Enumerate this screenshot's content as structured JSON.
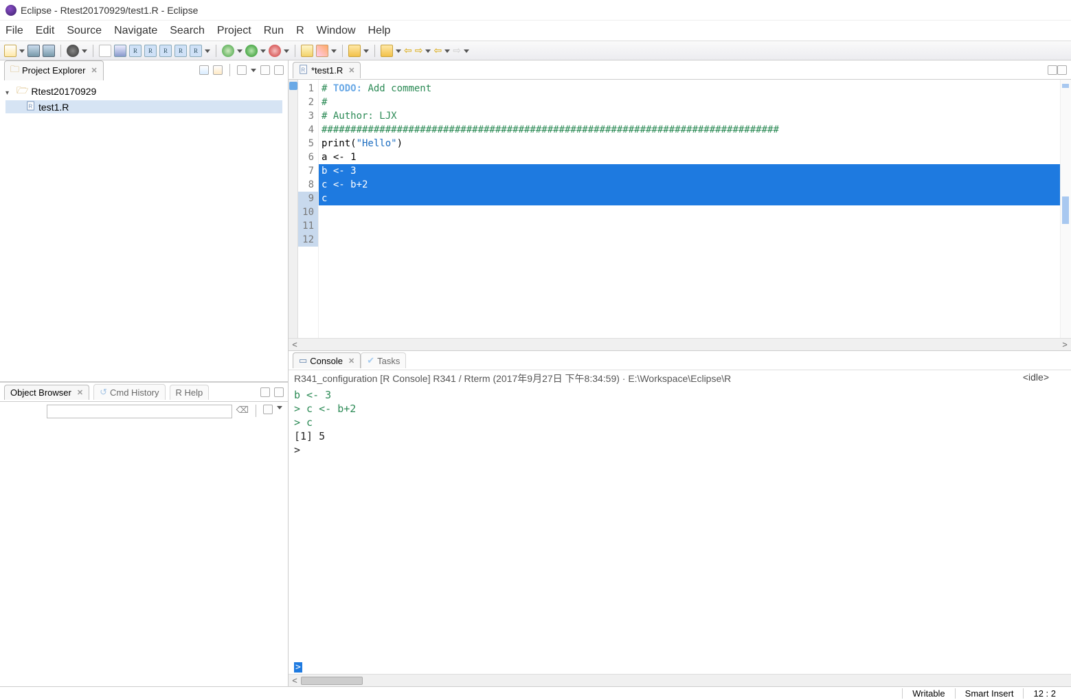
{
  "title": "Eclipse - Rtest20170929/test1.R - Eclipse",
  "menu": [
    "File",
    "Edit",
    "Source",
    "Navigate",
    "Search",
    "Project",
    "Run",
    "R",
    "Window",
    "Help"
  ],
  "projectExplorer": {
    "title": "Project Explorer",
    "projectName": "Rtest20170929",
    "fileName": "test1.R"
  },
  "objectBrowser": {
    "title": "Object Browser",
    "cmdHistory": "Cmd History",
    "rHelp": "R Help"
  },
  "editor": {
    "tabTitle": "*test1.R",
    "lines": [
      {
        "n": 1,
        "content": "# TODO: Add comment",
        "cmt": true,
        "todo": true
      },
      {
        "n": 2,
        "content": "# ",
        "cmt": true
      },
      {
        "n": 3,
        "content": "# Author: LJX",
        "cmt": true
      },
      {
        "n": 4,
        "content": "###############################################################################",
        "cmt": true
      },
      {
        "n": 5,
        "content": ""
      },
      {
        "n": 6,
        "content": ""
      },
      {
        "n": 7,
        "content": "print(\"Hello\")",
        "fn": true
      },
      {
        "n": 8,
        "content": ""
      },
      {
        "n": 9,
        "content": "a <- 1",
        "hl": true
      },
      {
        "n": 10,
        "content": "b <- 3",
        "sel": true
      },
      {
        "n": 11,
        "content": "c <- b+2",
        "sel": true
      },
      {
        "n": 12,
        "content": "c",
        "sel": true,
        "cursor": true
      }
    ]
  },
  "console": {
    "title": "Console",
    "tasks": "Tasks",
    "infoLine": "R341_configuration [R Console] R341 / Rterm (2017年9月27日 下午8:34:59)  ·  E:\\Workspace\\Eclipse\\R",
    "idle": "<idle>",
    "lines": [
      {
        "t": "hist",
        "s": "b <- 3"
      },
      {
        "t": "hist",
        "s": "> c <- b+2"
      },
      {
        "t": "hist",
        "s": "> c"
      },
      {
        "t": "out",
        "s": "[1] 5"
      },
      {
        "t": "out",
        "s": ">"
      }
    ],
    "prompt": ">"
  },
  "status": {
    "writable": "Writable",
    "insert": "Smart Insert",
    "pos": "12 : 2"
  }
}
